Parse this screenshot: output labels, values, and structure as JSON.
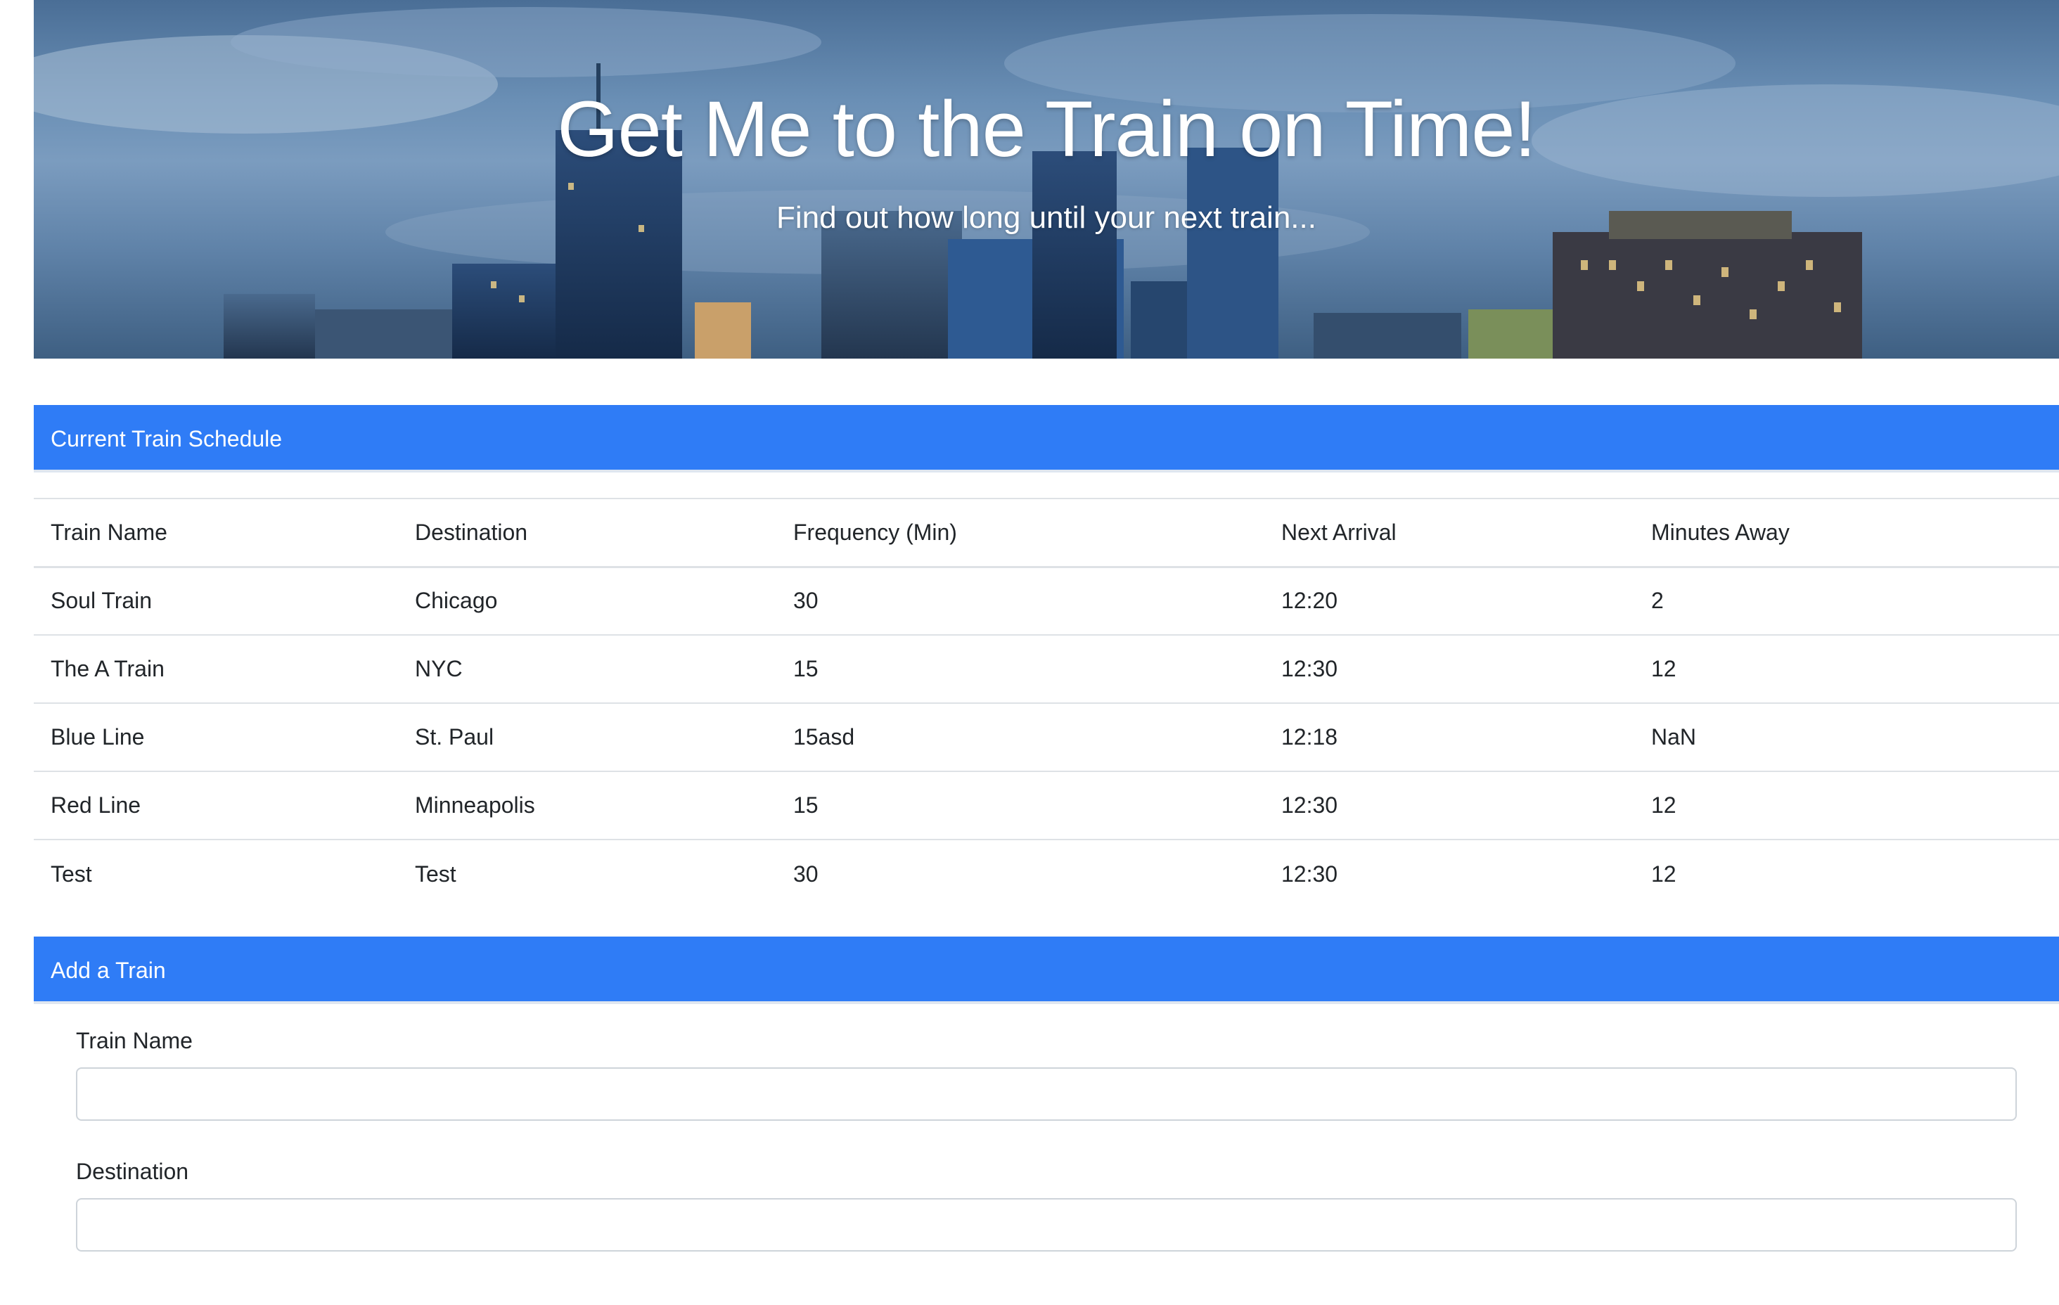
{
  "hero": {
    "title": "Get Me to the Train on Time!",
    "subtitle": "Find out how long until your next train..."
  },
  "schedule": {
    "header": "Current Train Schedule",
    "columns": [
      "Train Name",
      "Destination",
      "Frequency (Min)",
      "Next Arrival",
      "Minutes Away"
    ],
    "rows": [
      [
        "Soul Train",
        "Chicago",
        "30",
        "12:20",
        "2"
      ],
      [
        "The A Train",
        "NYC",
        "15",
        "12:30",
        "12"
      ],
      [
        "Blue Line",
        "St. Paul",
        "15asd",
        "12:18",
        "NaN"
      ],
      [
        "Red Line",
        "Minneapolis",
        "15",
        "12:30",
        "12"
      ],
      [
        "Test",
        "Test",
        "30",
        "12:30",
        "12"
      ]
    ]
  },
  "add_train": {
    "header": "Add a Train",
    "fields": [
      {
        "label": "Train Name",
        "value": "",
        "placeholder": ""
      },
      {
        "label": "Destination",
        "value": "",
        "placeholder": ""
      }
    ]
  },
  "colors": {
    "accent": "#2f7cf6",
    "border": "#dee2e6"
  }
}
